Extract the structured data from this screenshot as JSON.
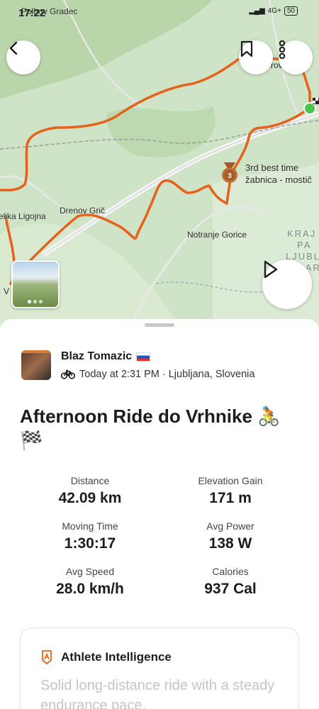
{
  "status_bar": {
    "time": "17:22",
    "place": "Polhov Gradec",
    "network": "4G+",
    "battery": "50"
  },
  "map": {
    "labels": {
      "dobrova": "Dobrova",
      "third_best": "3rd best time",
      "segment": "žabnica - mostič",
      "velika_ligojna": "elika Ligojna",
      "drenov_gric": "Drenov Grič",
      "notranje_gorice": "Notranje Gorice",
      "krajinski": "KRAJ",
      "park": "PA",
      "ljubljansko": "LJUBL",
      "barje": "BAR",
      "vrhnika_edge": "V"
    },
    "medal_rank": "3",
    "icons": {
      "back": "chevron-left-icon",
      "bookmark": "bookmark-icon",
      "more": "more-vertical-icon",
      "play": "play-icon"
    },
    "colors": {
      "route": "#e8611a",
      "start_marker": "#4cc44a"
    }
  },
  "athlete": {
    "name": "Blaz Tomazic",
    "meta": "Today at 2:31 PM · Ljubljana, Slovenia"
  },
  "activity": {
    "title": "Afternoon Ride do Vrhnike 🚴 🏁"
  },
  "stats": [
    {
      "label": "Distance",
      "value": "42.09 km"
    },
    {
      "label": "Elevation Gain",
      "value": "171 m"
    },
    {
      "label": "Moving Time",
      "value": "1:30:17"
    },
    {
      "label": "Avg Power",
      "value": "138 W"
    },
    {
      "label": "Avg Speed",
      "value": "28.0 km/h"
    },
    {
      "label": "Calories",
      "value": "937 Cal"
    }
  ],
  "athlete_intelligence": {
    "title": "Athlete Intelligence",
    "text": "Solid long-distance ride with a steady endurance pace."
  }
}
